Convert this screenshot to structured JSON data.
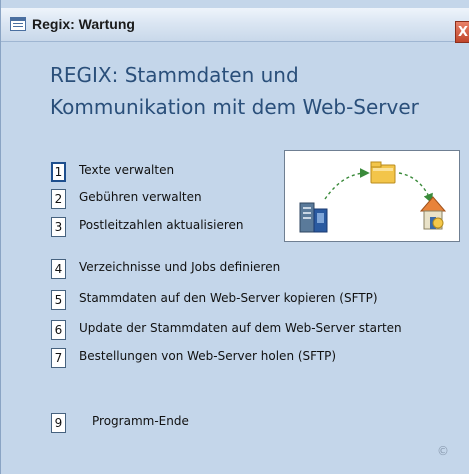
{
  "window": {
    "title": "Regix: Wartung",
    "close_glyph": "X"
  },
  "heading": {
    "line1": "REGIX: Stammdaten und",
    "line2": "Kommunikation mit dem Web-Server"
  },
  "menu": [
    {
      "number": "1",
      "label": "Texte verwalten"
    },
    {
      "number": "2",
      "label": "Gebühren verwalten"
    },
    {
      "number": "3",
      "label": "Postleitzahlen aktualisieren"
    },
    {
      "number": "4",
      "label": "Verzeichnisse und Jobs definieren"
    },
    {
      "number": "5",
      "label": "Stammdaten auf den Web-Server kopieren (SFTP)"
    },
    {
      "number": "6",
      "label": "Update der Stammdaten auf dem Web-Server starten"
    },
    {
      "number": "7",
      "label": "Bestellungen von Web-Server holen (SFTP)"
    }
  ],
  "exit": {
    "number": "9",
    "label": "Programm-Ende"
  },
  "copyright_symbol": "©",
  "illustration": {
    "icons": [
      "server-icon",
      "folder-icon",
      "home-icon"
    ],
    "colors": {
      "folder": "#f3c54a",
      "roof": "#e8833a",
      "arrow": "#3a8a3a",
      "server": "#5a7a9a"
    }
  }
}
